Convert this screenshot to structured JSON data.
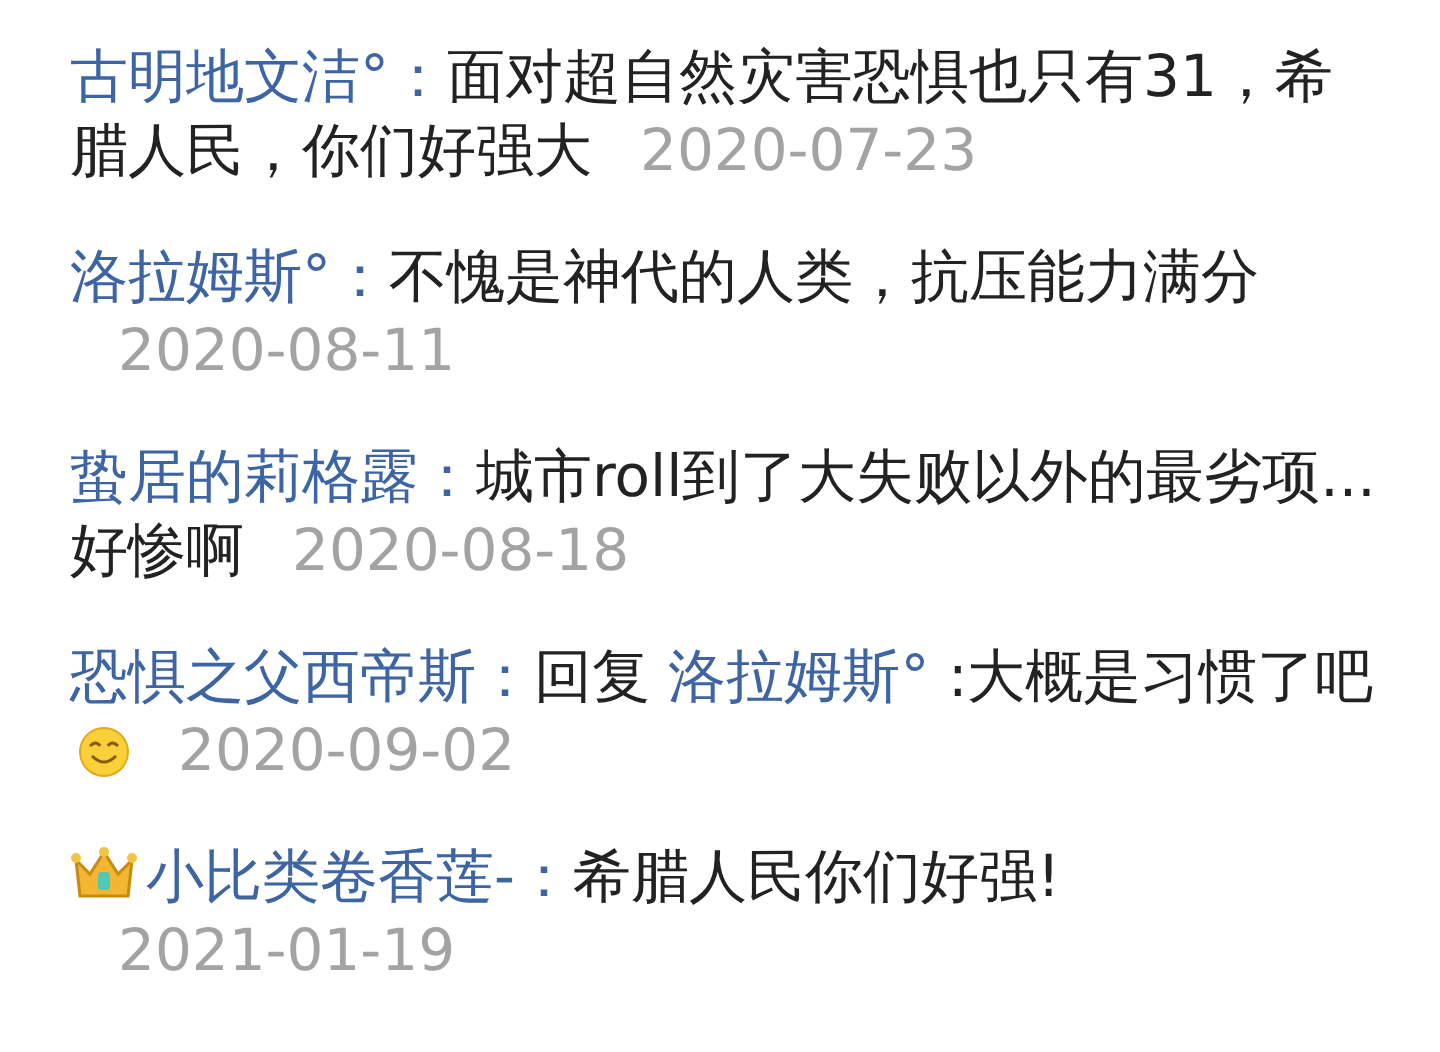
{
  "comments": [
    {
      "crown_badge": false,
      "author": "古明地文洁°：",
      "text": "面对超自然灾害恐惧也只有31，希腊人民，你们好强大",
      "has_emoji": false,
      "date": "2020-07-23"
    },
    {
      "crown_badge": false,
      "author": "洛拉姆斯°：",
      "text": "不愧是神代的人类，抗压能力满分",
      "has_emoji": false,
      "date": "2020-08-11"
    },
    {
      "crown_badge": false,
      "author": "蛰居的莉格露：",
      "text": "城市roll到了大失败以外的最劣项...好惨啊",
      "has_emoji": false,
      "date": "2020-08-18"
    },
    {
      "crown_badge": false,
      "author": "恐惧之父西帝斯：",
      "reply_prefix": "回复",
      "reply_to": "洛拉姆斯°",
      "text": ":大概是习惯了吧",
      "has_emoji": true,
      "date": "2020-09-02"
    },
    {
      "crown_badge": true,
      "author": "小比类卷香莲-：",
      "text": "希腊人民你们好强!",
      "has_emoji": false,
      "date": "2021-01-19"
    }
  ]
}
